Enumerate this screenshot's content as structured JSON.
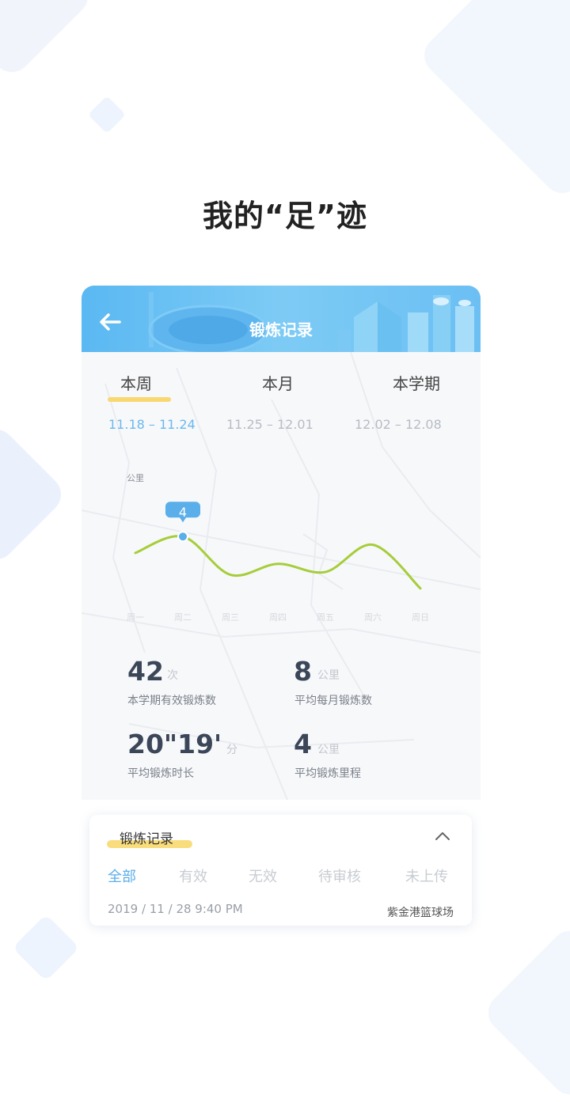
{
  "page_title": "我的“足”迹",
  "header": {
    "title": "锻炼记录"
  },
  "tabs": [
    {
      "label": "本周",
      "range": "11.18 – 11.24"
    },
    {
      "label": "本月",
      "range": "11.25 – 12.01"
    },
    {
      "label": "本学期",
      "range": "12.02 – 12.08"
    }
  ],
  "chart_data": {
    "type": "line",
    "ylabel": "公里",
    "categories": [
      "周一",
      "周二",
      "周三",
      "周四",
      "周五",
      "周六",
      "周日"
    ],
    "values": [
      3.4,
      4,
      2.6,
      3.0,
      2.7,
      3.7,
      2.1
    ],
    "highlight": {
      "index": 1,
      "label": "4"
    },
    "colors": {
      "line": "#a6cd3a",
      "marker": "#5aaee9"
    }
  },
  "stats": [
    {
      "value": "42",
      "unit": "次",
      "label": "本学期有效锻炼数"
    },
    {
      "value": "8",
      "unit": "公里",
      "label": "平均每月锻炼数"
    },
    {
      "value": "20\"19'",
      "unit": "分",
      "label": "平均锻炼时长"
    },
    {
      "value": "4",
      "unit": "公里",
      "label": "平均锻炼里程"
    }
  ],
  "records": {
    "title": "锻炼记录",
    "filters": [
      "全部",
      "有效",
      "无效",
      "待审核",
      "未上传"
    ],
    "items": [
      {
        "datetime": "2019 / 11 / 28   9:40 PM",
        "place": "紫金港篮球场"
      }
    ]
  }
}
